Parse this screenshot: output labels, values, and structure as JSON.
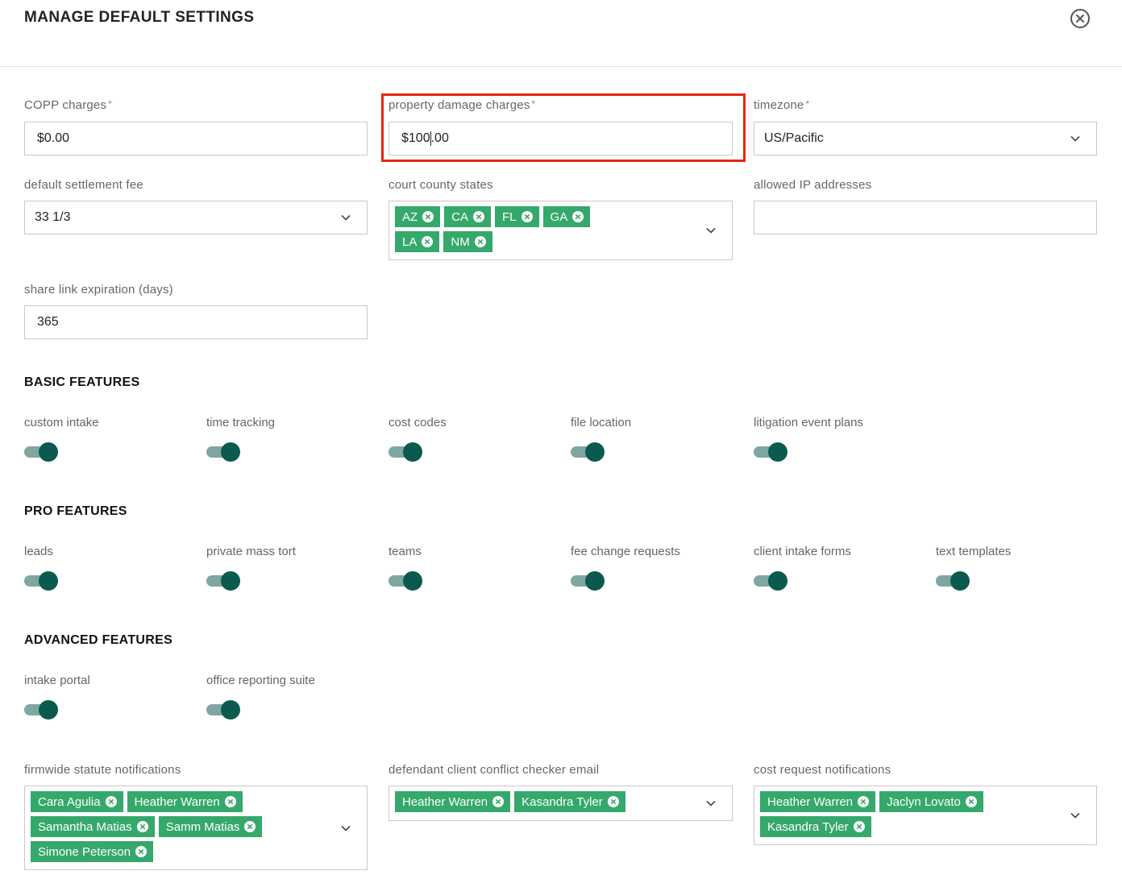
{
  "header": {
    "title": "MANAGE DEFAULT SETTINGS"
  },
  "fields": {
    "copp": {
      "label": "COPP charges",
      "required": "*",
      "value": "$0.00"
    },
    "property_damage": {
      "label": "property damage charges",
      "required": "*",
      "value_before_caret": "$100",
      "value_after_caret": ".00"
    },
    "timezone": {
      "label": "timezone",
      "required": "*",
      "value": "US/Pacific"
    },
    "settlement_fee": {
      "label": "default settlement fee",
      "value": "33 1/3"
    },
    "court_states": {
      "label": "court county states",
      "chips": [
        "AZ",
        "CA",
        "FL",
        "GA",
        "LA",
        "NM"
      ]
    },
    "allowed_ips": {
      "label": "allowed IP addresses",
      "value": ""
    },
    "share_link": {
      "label": "share link expiration (days)",
      "value": "365"
    }
  },
  "basic_features": {
    "title": "BASIC FEATURES",
    "toggles": [
      {
        "label": "custom intake",
        "on": true
      },
      {
        "label": "time tracking",
        "on": true
      },
      {
        "label": "cost codes",
        "on": true
      },
      {
        "label": "file location",
        "on": true
      },
      {
        "label": "litigation event plans",
        "on": true
      }
    ]
  },
  "pro_features": {
    "title": "PRO FEATURES",
    "toggles": [
      {
        "label": "leads",
        "on": true
      },
      {
        "label": "private mass tort",
        "on": true
      },
      {
        "label": "teams",
        "on": true
      },
      {
        "label": "fee change requests",
        "on": true
      },
      {
        "label": "client intake forms",
        "on": true
      },
      {
        "label": "text templates",
        "on": true
      }
    ]
  },
  "advanced_features": {
    "title": "ADVANCED FEATURES",
    "toggles": [
      {
        "label": "intake portal",
        "on": true
      },
      {
        "label": "office reporting suite",
        "on": true
      }
    ]
  },
  "notifications": {
    "statute": {
      "label": "firmwide statute notifications",
      "chips": [
        "Cara Agulia",
        "Heather Warren",
        "Samantha Matias",
        "Samm Matias",
        "Simone Peterson"
      ]
    },
    "conflict": {
      "label": "defendant client conflict checker email",
      "chips": [
        "Heather Warren",
        "Kasandra Tyler"
      ]
    },
    "cost_request": {
      "label": "cost request notifications",
      "chips": [
        "Heather Warren",
        "Jaclyn Lovato",
        "Kasandra Tyler"
      ]
    }
  },
  "colors": {
    "chip": "#35a86b",
    "toggle_knob": "#0b5a50",
    "toggle_track": "#7fa6a0",
    "highlight": "#e8250e"
  },
  "icons": {
    "close": "close-circle-icon",
    "chevron": "chevron-down-icon",
    "chip_remove": "remove-circle-icon"
  }
}
